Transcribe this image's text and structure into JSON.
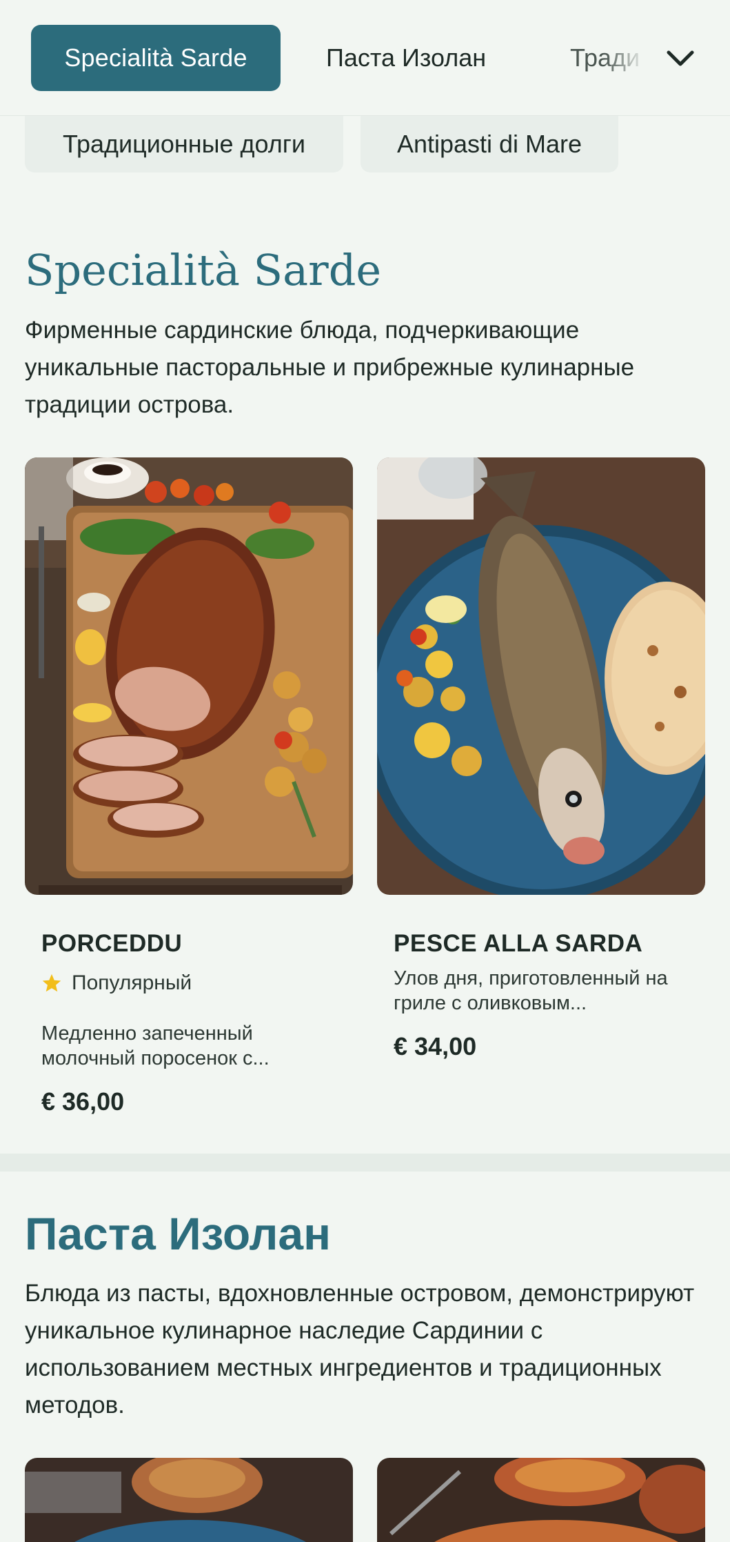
{
  "nav": {
    "tabs": [
      {
        "label": "Specialità Sarde",
        "active": true
      },
      {
        "label": "Паста Изолан"
      },
      {
        "label": "Тради"
      }
    ],
    "chips": [
      {
        "label": "Традиционные долги"
      },
      {
        "label": "Antipasti di Mare"
      }
    ],
    "expand_icon": "chevron-down-icon",
    "accent_color": "#2c6c7c"
  },
  "sections": [
    {
      "title": "Specialità Sarde",
      "description": "Фирменные сардинские блюда, подчеркивающие уникальные пасторальные и прибрежные кулинарные традиции острова.",
      "items": [
        {
          "name": "PORCEDDU",
          "badge": "Популярный",
          "badge_icon": "star-icon",
          "description": "Медленно запеченный молочный поросенок с...",
          "price": "€ 36,00"
        },
        {
          "name": "PESCE ALLA SARDA",
          "description": "Улов дня, приготовленный на гриле с оливковым...",
          "price": "€ 34,00"
        }
      ]
    },
    {
      "title": "Паста Изолан",
      "description": "Блюда из пасты, вдохновленные островом, демонстрируют уникальное кулинарное наследие Сардинии с использованием местных ингредиентов и традиционных методов."
    }
  ]
}
